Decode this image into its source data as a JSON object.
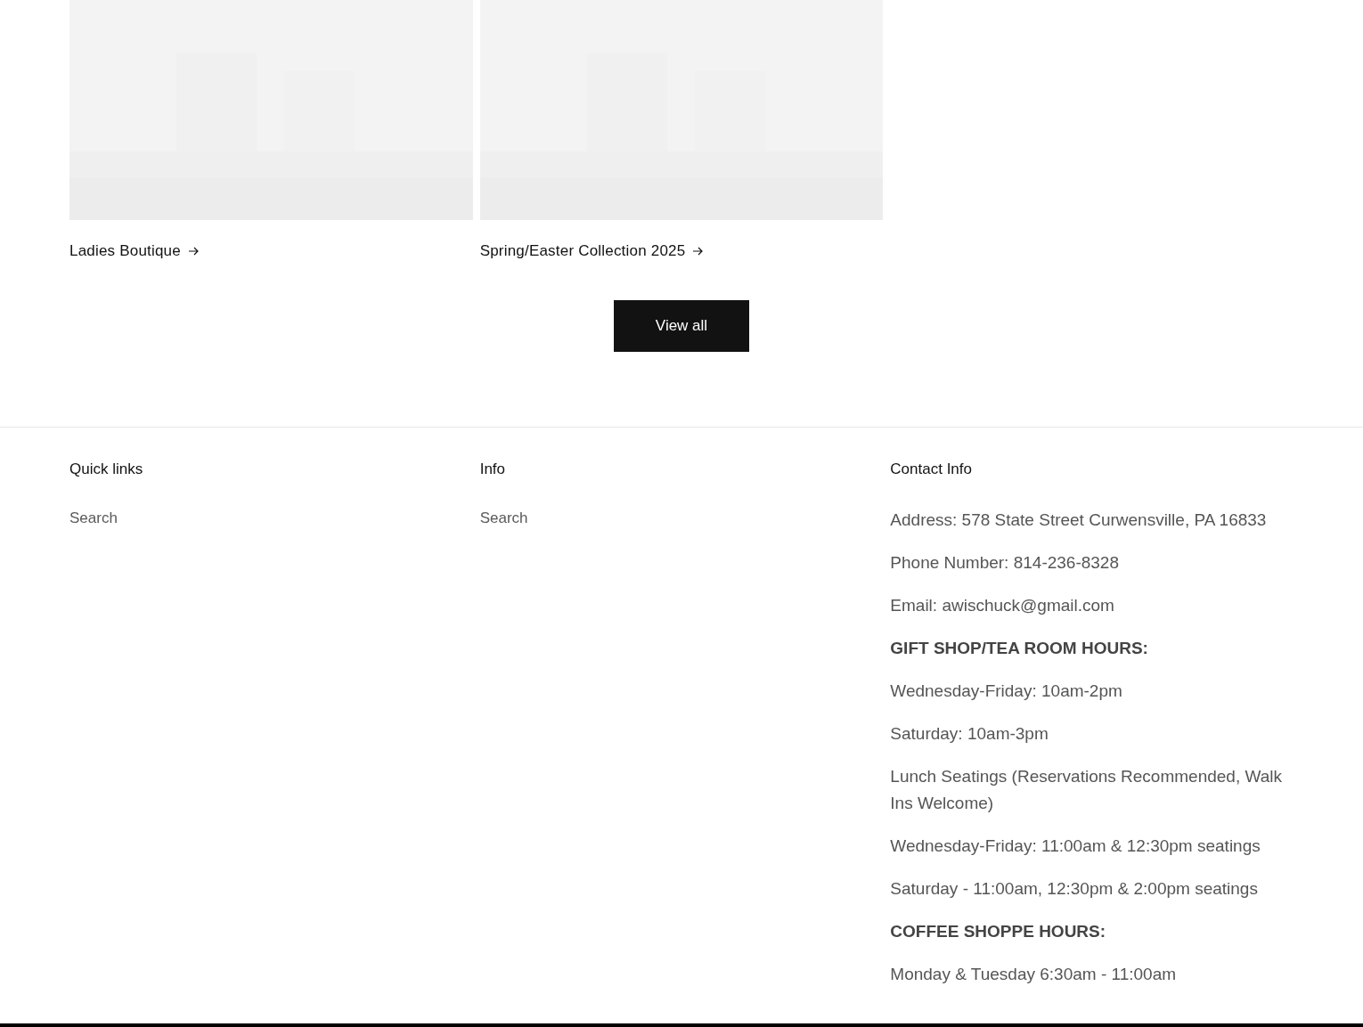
{
  "collections": [
    {
      "title": "Ladies Boutique"
    },
    {
      "title": "Spring/Easter Collection 2025"
    }
  ],
  "view_all_button": "View all",
  "footer": {
    "columns": [
      {
        "heading": "Quick links",
        "links": [
          "Search"
        ]
      },
      {
        "heading": "Info",
        "links": [
          "Search"
        ]
      },
      {
        "heading": "Contact Info",
        "lines": [
          {
            "kind": "text",
            "text": "Address: 578 State Street Curwensville, PA 16833"
          },
          {
            "kind": "text",
            "text": "Phone Number: 814-236-8328"
          },
          {
            "kind": "text",
            "text": "Email: awischuck@gmail.com"
          },
          {
            "kind": "heading",
            "text": "GIFT SHOP/TEA ROOM HOURS:"
          },
          {
            "kind": "text",
            "text": "Wednesday-Friday: 10am-2pm"
          },
          {
            "kind": "text",
            "text": "Saturday: 10am-3pm"
          },
          {
            "kind": "text",
            "text": "Lunch Seatings (Reservations Recommended, Walk Ins Welcome)"
          },
          {
            "kind": "text",
            "text": "Wednesday-Friday: 11:00am & 12:30pm seatings"
          },
          {
            "kind": "text",
            "text": "Saturday - 11:00am, 12:30pm & 2:00pm seatings"
          },
          {
            "kind": "heading",
            "text": "COFFEE SHOPPE HOURS:"
          },
          {
            "kind": "text",
            "text": "Monday & Tuesday 6:30am - 11:00am"
          }
        ]
      }
    ]
  }
}
